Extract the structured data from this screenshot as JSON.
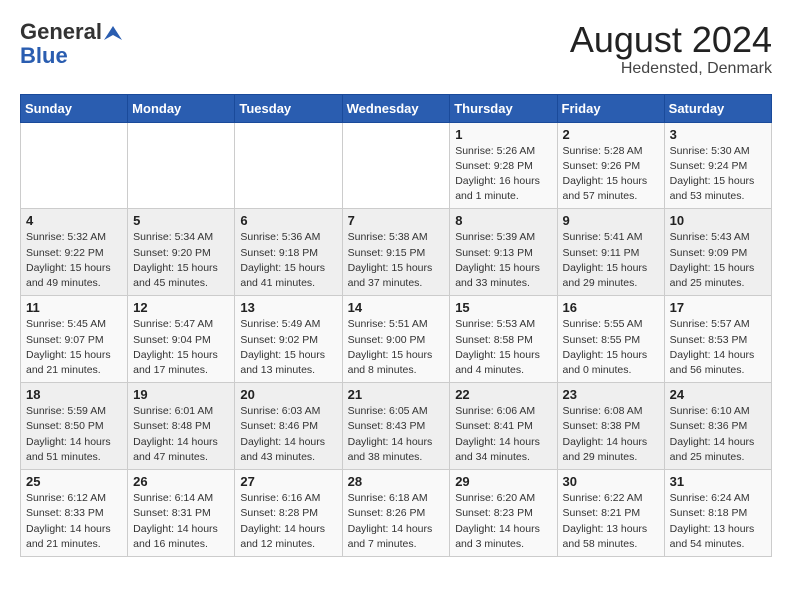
{
  "header": {
    "logo_general": "General",
    "logo_blue": "Blue",
    "month_title": "August 2024",
    "location": "Hedensted, Denmark"
  },
  "weekdays": [
    "Sunday",
    "Monday",
    "Tuesday",
    "Wednesday",
    "Thursday",
    "Friday",
    "Saturday"
  ],
  "weeks": [
    [
      {
        "day": "",
        "sunrise": "",
        "sunset": "",
        "daylight": ""
      },
      {
        "day": "",
        "sunrise": "",
        "sunset": "",
        "daylight": ""
      },
      {
        "day": "",
        "sunrise": "",
        "sunset": "",
        "daylight": ""
      },
      {
        "day": "",
        "sunrise": "",
        "sunset": "",
        "daylight": ""
      },
      {
        "day": "1",
        "sunrise": "Sunrise: 5:26 AM",
        "sunset": "Sunset: 9:28 PM",
        "daylight": "Daylight: 16 hours and 1 minute."
      },
      {
        "day": "2",
        "sunrise": "Sunrise: 5:28 AM",
        "sunset": "Sunset: 9:26 PM",
        "daylight": "Daylight: 15 hours and 57 minutes."
      },
      {
        "day": "3",
        "sunrise": "Sunrise: 5:30 AM",
        "sunset": "Sunset: 9:24 PM",
        "daylight": "Daylight: 15 hours and 53 minutes."
      }
    ],
    [
      {
        "day": "4",
        "sunrise": "Sunrise: 5:32 AM",
        "sunset": "Sunset: 9:22 PM",
        "daylight": "Daylight: 15 hours and 49 minutes."
      },
      {
        "day": "5",
        "sunrise": "Sunrise: 5:34 AM",
        "sunset": "Sunset: 9:20 PM",
        "daylight": "Daylight: 15 hours and 45 minutes."
      },
      {
        "day": "6",
        "sunrise": "Sunrise: 5:36 AM",
        "sunset": "Sunset: 9:18 PM",
        "daylight": "Daylight: 15 hours and 41 minutes."
      },
      {
        "day": "7",
        "sunrise": "Sunrise: 5:38 AM",
        "sunset": "Sunset: 9:15 PM",
        "daylight": "Daylight: 15 hours and 37 minutes."
      },
      {
        "day": "8",
        "sunrise": "Sunrise: 5:39 AM",
        "sunset": "Sunset: 9:13 PM",
        "daylight": "Daylight: 15 hours and 33 minutes."
      },
      {
        "day": "9",
        "sunrise": "Sunrise: 5:41 AM",
        "sunset": "Sunset: 9:11 PM",
        "daylight": "Daylight: 15 hours and 29 minutes."
      },
      {
        "day": "10",
        "sunrise": "Sunrise: 5:43 AM",
        "sunset": "Sunset: 9:09 PM",
        "daylight": "Daylight: 15 hours and 25 minutes."
      }
    ],
    [
      {
        "day": "11",
        "sunrise": "Sunrise: 5:45 AM",
        "sunset": "Sunset: 9:07 PM",
        "daylight": "Daylight: 15 hours and 21 minutes."
      },
      {
        "day": "12",
        "sunrise": "Sunrise: 5:47 AM",
        "sunset": "Sunset: 9:04 PM",
        "daylight": "Daylight: 15 hours and 17 minutes."
      },
      {
        "day": "13",
        "sunrise": "Sunrise: 5:49 AM",
        "sunset": "Sunset: 9:02 PM",
        "daylight": "Daylight: 15 hours and 13 minutes."
      },
      {
        "day": "14",
        "sunrise": "Sunrise: 5:51 AM",
        "sunset": "Sunset: 9:00 PM",
        "daylight": "Daylight: 15 hours and 8 minutes."
      },
      {
        "day": "15",
        "sunrise": "Sunrise: 5:53 AM",
        "sunset": "Sunset: 8:58 PM",
        "daylight": "Daylight: 15 hours and 4 minutes."
      },
      {
        "day": "16",
        "sunrise": "Sunrise: 5:55 AM",
        "sunset": "Sunset: 8:55 PM",
        "daylight": "Daylight: 15 hours and 0 minutes."
      },
      {
        "day": "17",
        "sunrise": "Sunrise: 5:57 AM",
        "sunset": "Sunset: 8:53 PM",
        "daylight": "Daylight: 14 hours and 56 minutes."
      }
    ],
    [
      {
        "day": "18",
        "sunrise": "Sunrise: 5:59 AM",
        "sunset": "Sunset: 8:50 PM",
        "daylight": "Daylight: 14 hours and 51 minutes."
      },
      {
        "day": "19",
        "sunrise": "Sunrise: 6:01 AM",
        "sunset": "Sunset: 8:48 PM",
        "daylight": "Daylight: 14 hours and 47 minutes."
      },
      {
        "day": "20",
        "sunrise": "Sunrise: 6:03 AM",
        "sunset": "Sunset: 8:46 PM",
        "daylight": "Daylight: 14 hours and 43 minutes."
      },
      {
        "day": "21",
        "sunrise": "Sunrise: 6:05 AM",
        "sunset": "Sunset: 8:43 PM",
        "daylight": "Daylight: 14 hours and 38 minutes."
      },
      {
        "day": "22",
        "sunrise": "Sunrise: 6:06 AM",
        "sunset": "Sunset: 8:41 PM",
        "daylight": "Daylight: 14 hours and 34 minutes."
      },
      {
        "day": "23",
        "sunrise": "Sunrise: 6:08 AM",
        "sunset": "Sunset: 8:38 PM",
        "daylight": "Daylight: 14 hours and 29 minutes."
      },
      {
        "day": "24",
        "sunrise": "Sunrise: 6:10 AM",
        "sunset": "Sunset: 8:36 PM",
        "daylight": "Daylight: 14 hours and 25 minutes."
      }
    ],
    [
      {
        "day": "25",
        "sunrise": "Sunrise: 6:12 AM",
        "sunset": "Sunset: 8:33 PM",
        "daylight": "Daylight: 14 hours and 21 minutes."
      },
      {
        "day": "26",
        "sunrise": "Sunrise: 6:14 AM",
        "sunset": "Sunset: 8:31 PM",
        "daylight": "Daylight: 14 hours and 16 minutes."
      },
      {
        "day": "27",
        "sunrise": "Sunrise: 6:16 AM",
        "sunset": "Sunset: 8:28 PM",
        "daylight": "Daylight: 14 hours and 12 minutes."
      },
      {
        "day": "28",
        "sunrise": "Sunrise: 6:18 AM",
        "sunset": "Sunset: 8:26 PM",
        "daylight": "Daylight: 14 hours and 7 minutes."
      },
      {
        "day": "29",
        "sunrise": "Sunrise: 6:20 AM",
        "sunset": "Sunset: 8:23 PM",
        "daylight": "Daylight: 14 hours and 3 minutes."
      },
      {
        "day": "30",
        "sunrise": "Sunrise: 6:22 AM",
        "sunset": "Sunset: 8:21 PM",
        "daylight": "Daylight: 13 hours and 58 minutes."
      },
      {
        "day": "31",
        "sunrise": "Sunrise: 6:24 AM",
        "sunset": "Sunset: 8:18 PM",
        "daylight": "Daylight: 13 hours and 54 minutes."
      }
    ]
  ]
}
